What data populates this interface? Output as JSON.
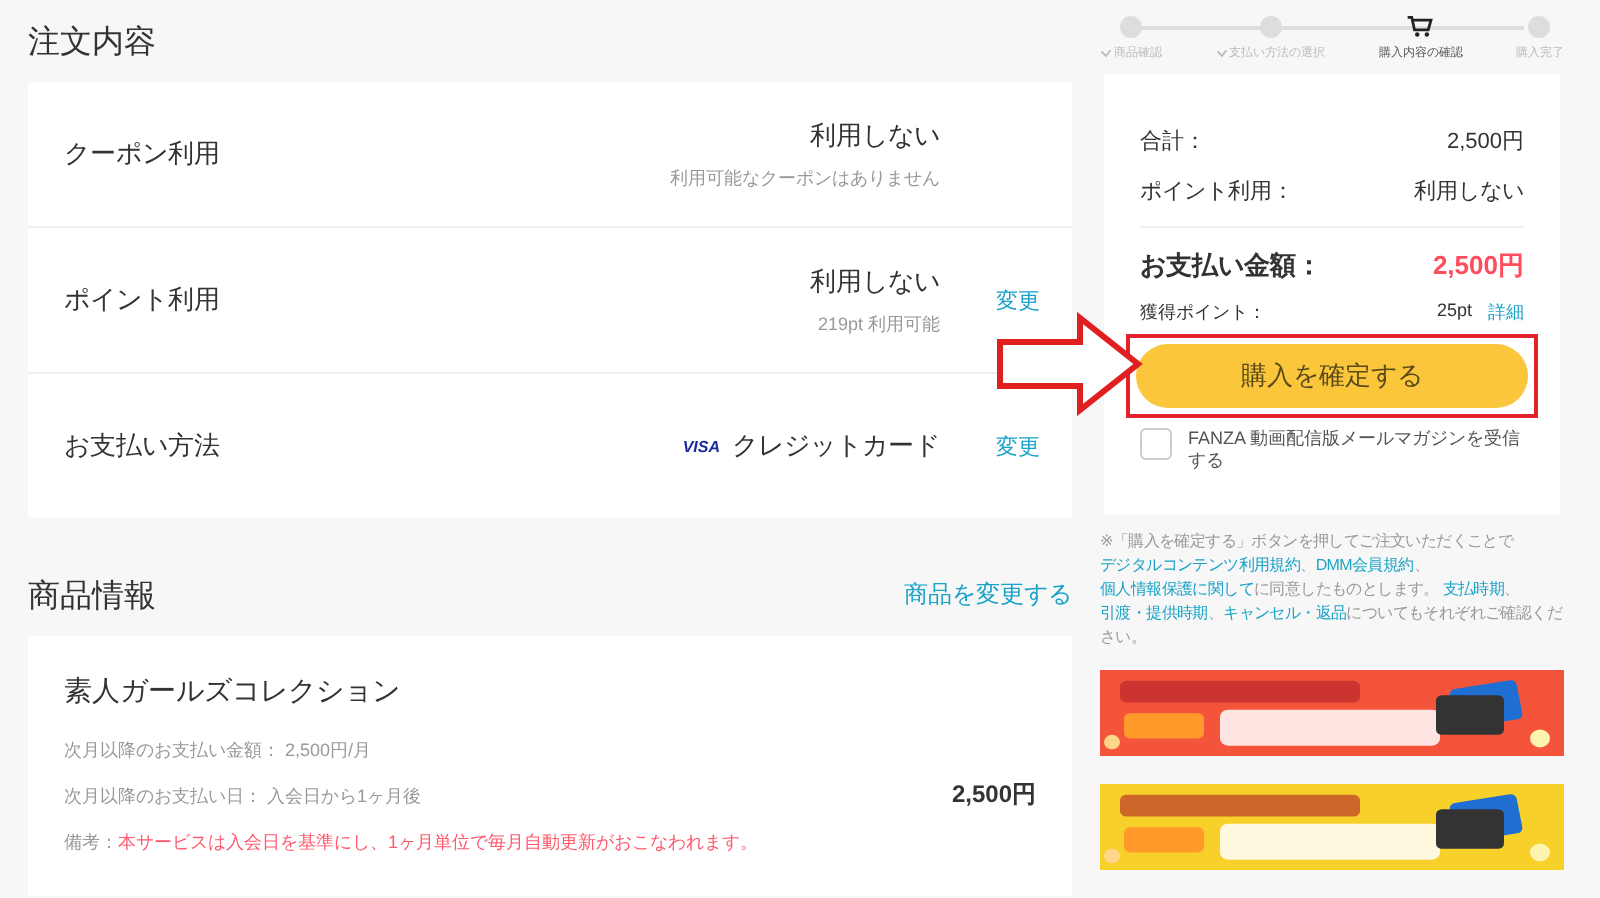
{
  "order": {
    "title": "注文内容",
    "rows": [
      {
        "label": "クーポン利用",
        "value": "利用しない",
        "note": "利用可能なクーポンはありません"
      },
      {
        "label": "ポイント利用",
        "value": "利用しない",
        "note": "219pt 利用可能",
        "action": "変更"
      },
      {
        "label": "お支払い方法",
        "brand": "VISA",
        "value": "クレジットカード",
        "action": "変更"
      }
    ]
  },
  "product": {
    "title": "商品情報",
    "change_link": "商品を変更する",
    "name": "素人ガールズコレクション",
    "details": [
      {
        "label": "次月以降のお支払い金額：",
        "value": "2,500円/月"
      },
      {
        "label": "次月以降のお支払い日：",
        "value": "入会日から1ヶ月後"
      }
    ],
    "remark": {
      "label": "備考：",
      "text": "本サービスは入会日を基準にし、1ヶ月単位で毎月自動更新がおこなわれます。"
    },
    "price": "2,500円"
  },
  "steps": [
    {
      "label": "商品確認",
      "done": true,
      "current": false
    },
    {
      "label": "支払い方法の選択",
      "done": true,
      "current": false
    },
    {
      "label": "購入内容の確認",
      "done": false,
      "current": true
    },
    {
      "label": "購入完了",
      "done": false,
      "current": false
    }
  ],
  "summary": {
    "lines": [
      {
        "label": "合計：",
        "value": "2,500円"
      },
      {
        "label": "ポイント利用：",
        "value": "利用しない"
      }
    ],
    "total": {
      "label": "お支払い金額：",
      "value": "2,500円"
    },
    "points": {
      "label": "獲得ポイント：",
      "value": "25pt",
      "link": "詳細"
    },
    "confirm_button": "購入を確定する",
    "highlighted": true,
    "newsletter": {
      "label": "FANZA 動画配信版メールマガジンを受信する",
      "checked": false
    }
  },
  "terms": [
    {
      "text": "※「購入を確定する」ボタンを押してご注文いただくことで ",
      "link": false
    },
    {
      "text": "デジタルコンテンツ利用規約",
      "link": true
    },
    {
      "text": "、",
      "link": false
    },
    {
      "text": "DMM会員規約",
      "link": true
    },
    {
      "text": "、",
      "link": false
    },
    {
      "text": "個人情報保護に関して",
      "link": true
    },
    {
      "text": "に同意したものとします。 ",
      "link": false
    },
    {
      "text": "支払時期",
      "link": true
    },
    {
      "text": "、",
      "link": false
    },
    {
      "text": "引渡・提供時期",
      "link": true
    },
    {
      "text": "、",
      "link": false
    },
    {
      "text": "キャンセル・返品",
      "link": true
    },
    {
      "text": "についてもそれぞれご確認ください。",
      "link": false
    }
  ]
}
